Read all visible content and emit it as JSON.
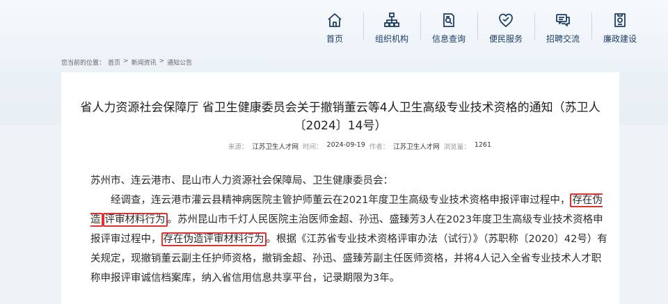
{
  "nav": {
    "items": [
      {
        "label": "首页",
        "icon": "home-icon"
      },
      {
        "label": "组织机构",
        "icon": "org-chart-icon"
      },
      {
        "label": "信息查询",
        "icon": "document-search-icon"
      },
      {
        "label": "便民服务",
        "icon": "heart-icon"
      },
      {
        "label": "招聘交流",
        "icon": "chat-icon"
      },
      {
        "label": "廉政建设",
        "icon": "badge-icon"
      }
    ],
    "accent": "#1c3d66"
  },
  "breadcrumb": {
    "prefix": "您当前的位置：",
    "items": [
      "首页",
      "新闻资讯",
      "通知公告"
    ],
    "separator": ">"
  },
  "article": {
    "title_line1": "省人力资源社会保障厅 省卫生健康委员会关于撤销董云等4人卫生高级专业技术资格的通知（苏卫人",
    "title_line2": "〔2024〕14号）",
    "meta": {
      "source_label": "来源：",
      "source": "江苏卫生人才网",
      "time_label": "时间：",
      "time": "2024-09-19",
      "author_label": "作者：",
      "author": "江苏卫生人才网",
      "views_label": "浏览量：",
      "views": "1261"
    },
    "salutation": "苏州市、连云港市、昆山市人力资源社会保障局、卫生健康委员会：",
    "para_a": "经调查，连云港市灌云县精神病医院主管护师董云在2021年度卫生高级专业技术资格申报评审过程中，",
    "hl1a": "存在伪造",
    "hl1b": "评审材料行为",
    "para_b": "。苏州昆山市千灯人民医院主治医师金超、孙迅、盛臻芳3人在2023年度卫生高级专业技术资格申报评审过程中，",
    "hl2": "存在伪造评审材料行为",
    "para_c": "。根据《江苏省专业技术资格评审办法（试行）》（苏职称〔2020〕42号）有关规定，现撤销董云副主任护师资格，撤销金超、孙迅、盛臻芳副主任医师资格，并将4人记入全省专业技术人才职称申报评审诚信档案库，纳入省信用信息共享平台，记录期限为3年。",
    "highlight_color": "#e03030"
  }
}
